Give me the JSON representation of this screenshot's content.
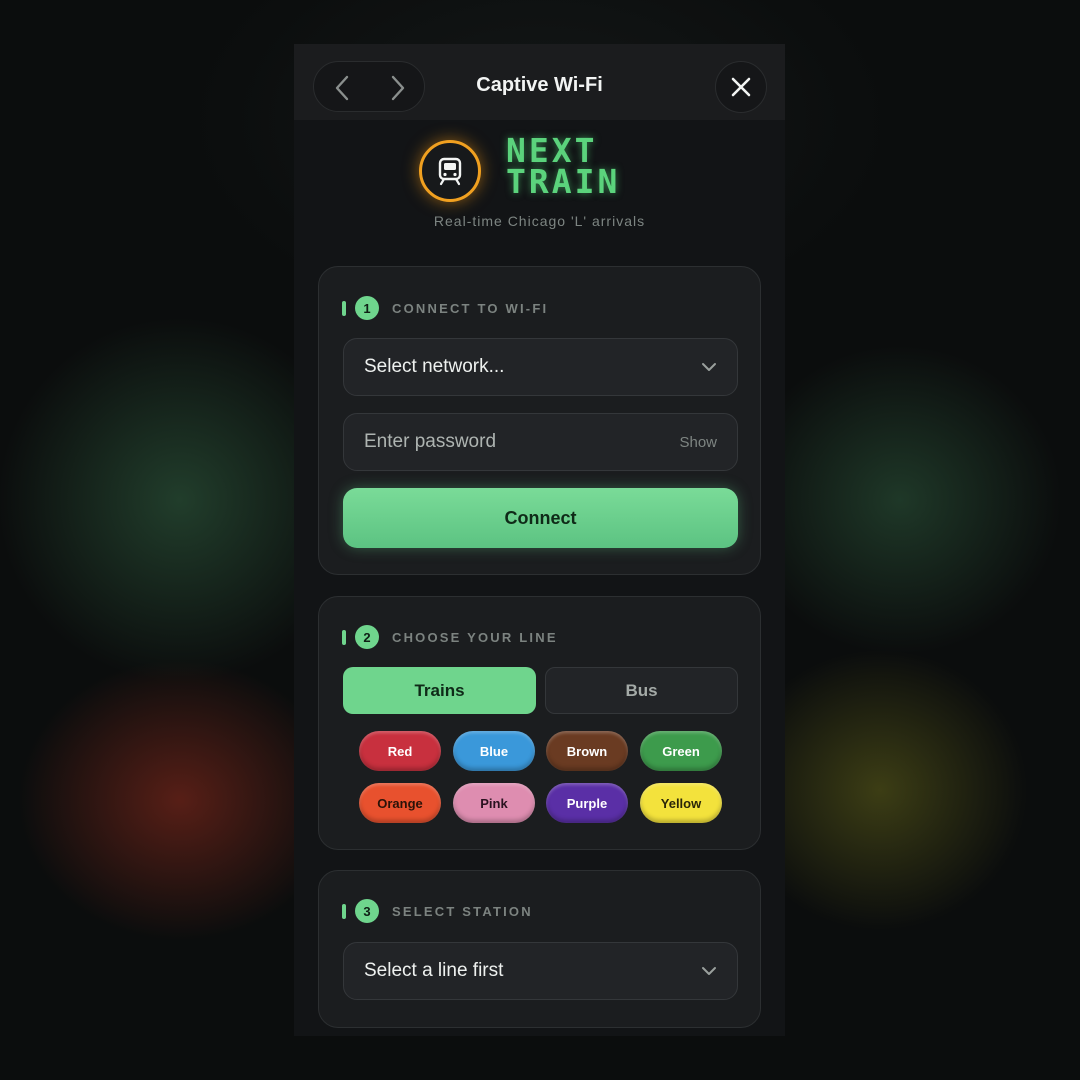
{
  "header": {
    "title": "Captive Wi-Fi",
    "back_icon": "chevron-left-icon",
    "forward_icon": "chevron-right-icon",
    "close_icon": "close-icon"
  },
  "brand": {
    "logo_icon": "train-icon",
    "name_line1": "NEXT",
    "name_line2": "TRAIN",
    "tagline": "Real-time Chicago 'L' arrivals",
    "accent": "#5bd37c",
    "badge_color": "#f0a020"
  },
  "wifi": {
    "step_number": "1",
    "step_title": "CONNECT TO WI-FI",
    "network_select": "Select network...",
    "password_placeholder": "Enter password",
    "show_label": "Show",
    "connect_label": "Connect"
  },
  "line": {
    "step_number": "2",
    "step_title": "CHOOSE YOUR LINE",
    "mode_trains": "Trains",
    "mode_bus": "Bus",
    "selected_mode": "Trains",
    "lines": [
      {
        "label": "Red",
        "color": "#c8303e",
        "text": "#ffffff"
      },
      {
        "label": "Blue",
        "color": "#3a98da",
        "text": "#ffffff"
      },
      {
        "label": "Brown",
        "color": "#6a3b22",
        "text": "#ffffff"
      },
      {
        "label": "Green",
        "color": "#3d9b4c",
        "text": "#ffffff"
      },
      {
        "label": "Orange",
        "color": "#e8512e",
        "text": "#2a1208"
      },
      {
        "label": "Pink",
        "color": "#de8db0",
        "text": "#2a1220"
      },
      {
        "label": "Purple",
        "color": "#5a2fa6",
        "text": "#ffffff"
      },
      {
        "label": "Yellow",
        "color": "#f3e23c",
        "text": "#2a2608"
      }
    ]
  },
  "station": {
    "step_number": "3",
    "step_title": "SELECT STATION",
    "station_select": "Select a line first"
  }
}
